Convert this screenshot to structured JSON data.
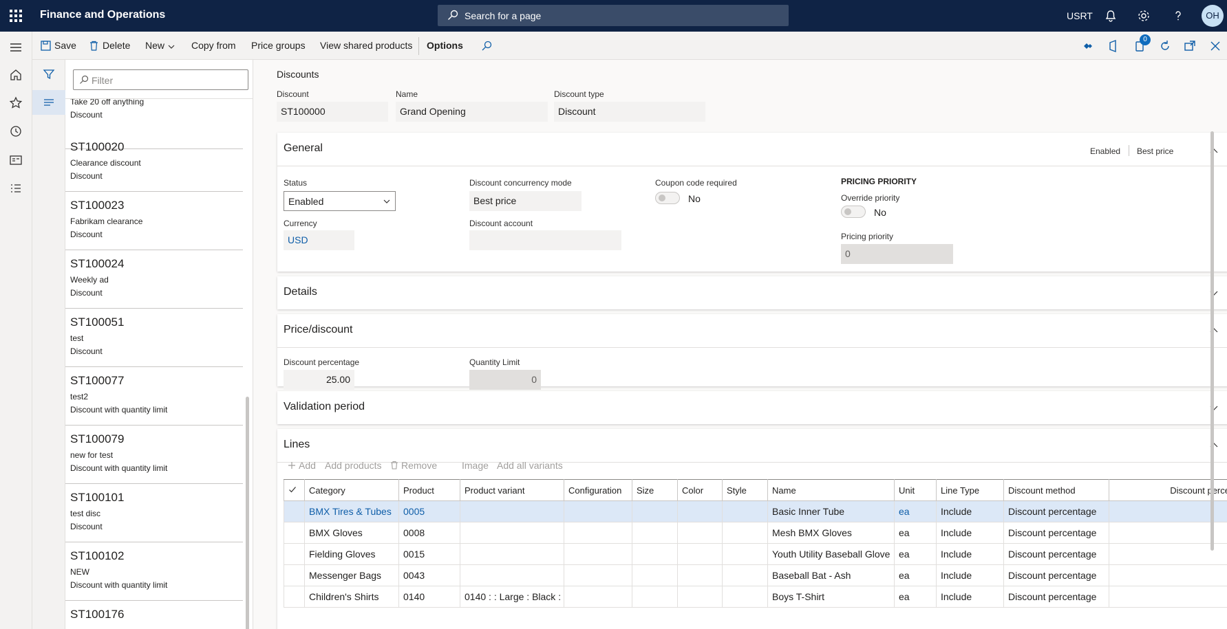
{
  "topbar": {
    "app_name": "Finance and Operations",
    "search_placeholder": "Search for a page",
    "company": "USRT",
    "avatar_initials": "OH"
  },
  "actions": {
    "save": "Save",
    "delete": "Delete",
    "new": "New",
    "copy_from": "Copy from",
    "price_groups": "Price groups",
    "view_shared_products": "View shared products",
    "options": "Options",
    "notification_count": "0"
  },
  "listpane": {
    "filter_placeholder": "Filter",
    "items": [
      {
        "id": "",
        "name": "Take 20 off anything",
        "type": "Discount"
      },
      {
        "id": "ST100020",
        "name": "Clearance discount",
        "type": "Discount"
      },
      {
        "id": "ST100023",
        "name": "Fabrikam clearance",
        "type": "Discount"
      },
      {
        "id": "ST100024",
        "name": "Weekly ad",
        "type": "Discount"
      },
      {
        "id": "ST100051",
        "name": "test",
        "type": "Discount"
      },
      {
        "id": "ST100077",
        "name": "test2",
        "type": "Discount with quantity limit"
      },
      {
        "id": "ST100079",
        "name": "new for test",
        "type": "Discount with quantity limit"
      },
      {
        "id": "ST100101",
        "name": "test disc",
        "type": "Discount"
      },
      {
        "id": "ST100102",
        "name": "NEW",
        "type": "Discount with quantity limit"
      },
      {
        "id": "ST100176",
        "name": "",
        "type": ""
      }
    ]
  },
  "header": {
    "breadcrumb": "Discounts",
    "discount_label": "Discount",
    "discount_value": "ST100000",
    "name_label": "Name",
    "name_value": "Grand Opening",
    "type_label": "Discount type",
    "type_value": "Discount"
  },
  "general": {
    "title": "General",
    "summary_status": "Enabled",
    "summary_mode": "Best price",
    "status_label": "Status",
    "status_value": "Enabled",
    "currency_label": "Currency",
    "currency_value": "USD",
    "concurrency_label": "Discount concurrency mode",
    "concurrency_value": "Best price",
    "account_label": "Discount account",
    "account_value": "",
    "coupon_label": "Coupon code required",
    "coupon_value": "No",
    "pricing_group": "PRICING PRIORITY",
    "override_label": "Override priority",
    "override_value": "No",
    "priority_label": "Pricing priority",
    "priority_value": "0"
  },
  "details": {
    "title": "Details"
  },
  "price_discount": {
    "title": "Price/discount",
    "pct_label": "Discount percentage",
    "pct_value": "25.00",
    "qty_label": "Quantity Limit",
    "qty_value": "0"
  },
  "validation": {
    "title": "Validation period"
  },
  "lines": {
    "title": "Lines",
    "toolbar": {
      "add": "Add",
      "add_products": "Add products",
      "remove": "Remove",
      "image": "Image",
      "add_all_variants": "Add all variants"
    },
    "columns": [
      "Category",
      "Product",
      "Product variant",
      "Configuration",
      "Size",
      "Color",
      "Style",
      "Name",
      "Unit",
      "Line Type",
      "Discount method",
      "Discount perce"
    ],
    "rows": [
      [
        "BMX Tires & Tubes",
        "0005",
        "",
        "",
        "",
        "",
        "",
        "Basic Inner Tube",
        "ea",
        "Include",
        "Discount percentage",
        ""
      ],
      [
        "BMX Gloves",
        "0008",
        "",
        "",
        "",
        "",
        "",
        "Mesh BMX Gloves",
        "ea",
        "Include",
        "Discount percentage",
        ""
      ],
      [
        "Fielding Gloves",
        "0015",
        "",
        "",
        "",
        "",
        "",
        "Youth Utility Baseball Glove",
        "ea",
        "Include",
        "Discount percentage",
        ""
      ],
      [
        "Messenger Bags",
        "0043",
        "",
        "",
        "",
        "",
        "",
        "Baseball Bat - Ash",
        "ea",
        "Include",
        "Discount percentage",
        ""
      ],
      [
        "Children's Shirts",
        "0140",
        "0140 :  : Large : Black :",
        "",
        "",
        "",
        "",
        "Boys T-Shirt",
        "ea",
        "Include",
        "Discount percentage",
        ""
      ]
    ]
  },
  "colors": {
    "topbar_bg": "#0f2345",
    "link": "#0f5ea8",
    "selected_row": "#dce8f7"
  }
}
